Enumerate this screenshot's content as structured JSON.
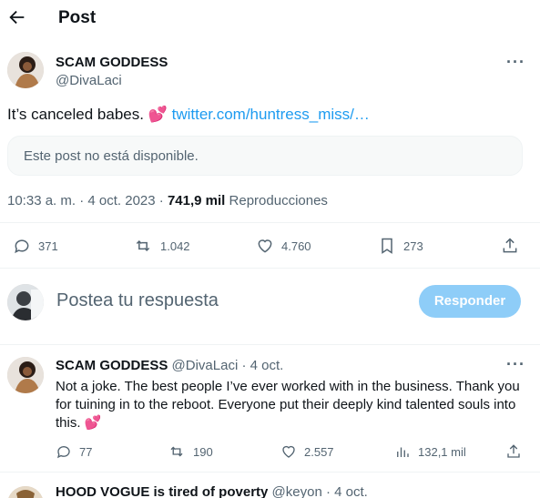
{
  "header": {
    "title": "Post",
    "back_icon": "arrow-left-icon"
  },
  "main_tweet": {
    "author_name": "SCAM GODDESS",
    "author_handle": "@DivaLaci",
    "text": "It’s canceled babes. ",
    "emoji": "💕",
    "link": "twitter.com/huntress_miss/…",
    "quote_unavailable": "Este post no está disponible.",
    "time": "10:33 a. m.",
    "date": "4 oct. 2023",
    "views": "741,9 mil",
    "views_label": "Reproducciones",
    "actions": {
      "replies": "371",
      "reposts": "1.042",
      "likes": "4.760",
      "bookmarks": "273"
    }
  },
  "composer": {
    "placeholder": "Postea tu respuesta",
    "button_label": "Responder"
  },
  "reply": {
    "author_name": "SCAM GODDESS",
    "author_handle": "@DivaLaci",
    "date": "4 oct.",
    "text": "Not a joke. The best people I’ve ever worked with in the business. Thank you for tuining in to the reboot. Everyone put their deeply kind talented souls into this. ",
    "emoji": "💕",
    "actions": {
      "replies": "77",
      "reposts": "190",
      "likes": "2.557",
      "views": "132,1 mil"
    }
  },
  "next_reply": {
    "author_name": "HOOD VOGUE is tired of poverty",
    "author_handle": "@keyon",
    "date": "4 oct."
  },
  "colors": {
    "accent": "#1d9bf0",
    "button_disabled": "#8ecdf8",
    "muted": "#536471"
  }
}
